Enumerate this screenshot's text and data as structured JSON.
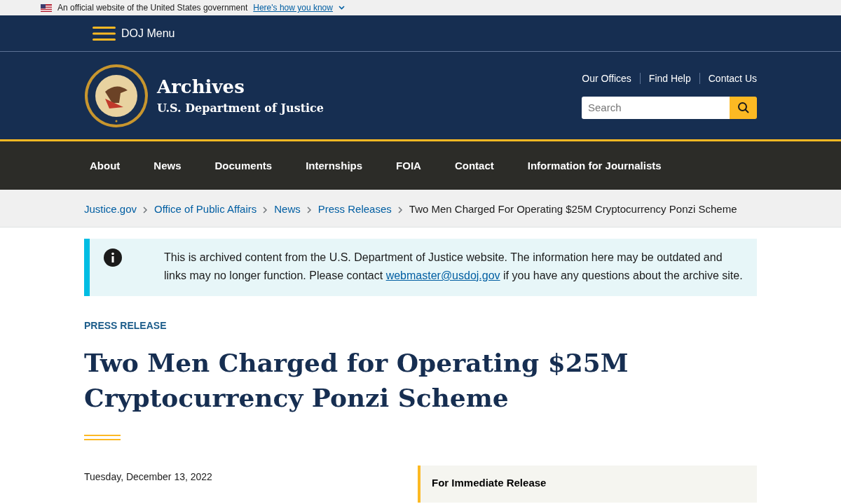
{
  "gov_banner": {
    "text": "An official website of the United States government",
    "link": "Here's how you know"
  },
  "menu_bar": {
    "label": "DOJ Menu"
  },
  "header": {
    "title": "Archives",
    "subtitle": "U.S. Department of Justice",
    "utility_links": [
      "Our Offices",
      "Find Help",
      "Contact Us"
    ],
    "search": {
      "placeholder": "Search"
    }
  },
  "nav": [
    "About",
    "News",
    "Documents",
    "Internships",
    "FOIA",
    "Contact",
    "Information for Journalists"
  ],
  "breadcrumb": {
    "links": [
      "Justice.gov",
      "Office of Public Affairs",
      "News",
      "Press Releases"
    ],
    "current": "Two Men Charged For Operating $25M Cryptocurrency Ponzi Scheme"
  },
  "alert": {
    "before": "This is archived content from the U.S. Department of Justice website. The information here may be outdated and links may no longer function. Please contact ",
    "link": "webmaster@usdoj.gov",
    "after": " if you have any questions about the archive site."
  },
  "article": {
    "eyebrow": "PRESS RELEASE",
    "title": "Two Men Charged for Operating $25M Cryptocurrency Ponzi Scheme",
    "date": "Tuesday, December 13, 2022",
    "aside_title": "For Immediate Release"
  }
}
